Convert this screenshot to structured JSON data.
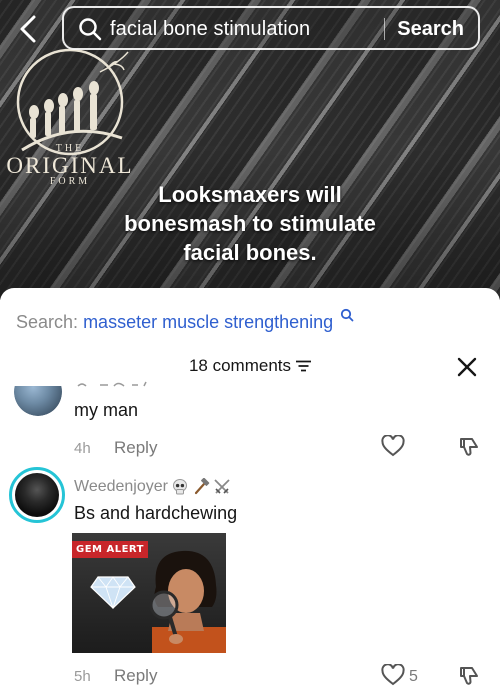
{
  "top_bar": {
    "query": "facial bone stimulation",
    "search_label": "Search"
  },
  "video": {
    "logo_top": "THE",
    "logo_main": "ORIGINAL",
    "logo_bottom": "FORM",
    "caption": "Looksmaxers will bonesmash to stimulate facial bones."
  },
  "comments_sheet": {
    "suggestion_label": "Search:",
    "suggestion_term": "masseter muscle strengthening",
    "count_label": "18 comments",
    "comments": [
      {
        "text": "my man",
        "time": "4h",
        "reply_label": "Reply"
      },
      {
        "username": "Weedenjoyer",
        "username_emojis": [
          "skull-icon",
          "hammer-icon",
          "crossed-swords-icon"
        ],
        "text": "Bs and hardchewing",
        "image_badge": "GEM ALERT",
        "time": "5h",
        "reply_label": "Reply",
        "like_count": "5"
      }
    ]
  },
  "colors": {
    "link_blue": "#2f5fcf",
    "avatar_ring": "#25c4d6",
    "badge_red": "#c8262a"
  }
}
